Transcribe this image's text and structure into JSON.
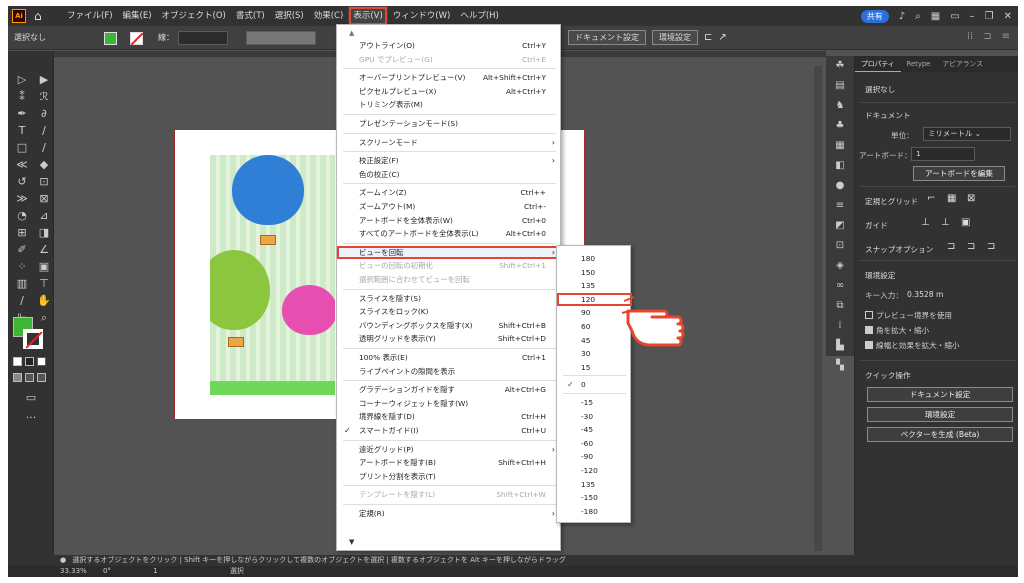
{
  "menubar": {
    "logo": "Ai",
    "items": [
      "ファイル(F)",
      "編集(E)",
      "オブジェクト(O)",
      "書式(T)",
      "選択(S)",
      "効果(C)",
      "表示(V)",
      "ウィンドウ(W)",
      "ヘルプ(H)"
    ],
    "active_index": 6,
    "share_label": "共有"
  },
  "controlbar": {
    "selection_label": "選択なし",
    "stroke_label": "線：",
    "document_setup": "ドキュメント設定",
    "preferences": "環境設定"
  },
  "view_menu": {
    "items": [
      {
        "label": "アウトライン(O)",
        "shortcut": "Ctrl+Y"
      },
      {
        "label": "GPU でプレビュー(G)",
        "shortcut": "Ctrl+E",
        "disabled": true
      },
      {
        "sep": true
      },
      {
        "label": "オーバープリントプレビュー(V)",
        "shortcut": "Alt+Shift+Ctrl+Y"
      },
      {
        "label": "ピクセルプレビュー(X)",
        "shortcut": "Alt+Ctrl+Y"
      },
      {
        "label": "トリミング表示(M)",
        "shortcut": ""
      },
      {
        "sep": true
      },
      {
        "label": "プレゼンテーションモード(S)",
        "shortcut": ""
      },
      {
        "sep": true
      },
      {
        "label": "スクリーンモード",
        "shortcut": "",
        "submenu": true
      },
      {
        "sep": true
      },
      {
        "label": "校正設定(F)",
        "shortcut": "",
        "submenu": true
      },
      {
        "label": "色の校正(C)",
        "shortcut": ""
      },
      {
        "sep": true
      },
      {
        "label": "ズームイン(Z)",
        "shortcut": "Ctrl++"
      },
      {
        "label": "ズームアウト(M)",
        "shortcut": "Ctrl+-"
      },
      {
        "label": "アートボードを全体表示(W)",
        "shortcut": "Ctrl+0"
      },
      {
        "label": "すべてのアートボードを全体表示(L)",
        "shortcut": "Alt+Ctrl+0"
      },
      {
        "sep": true
      },
      {
        "label": "ビューを回転",
        "shortcut": "",
        "submenu": true,
        "highlight": true
      },
      {
        "label": "ビューの回転の初期化",
        "shortcut": "Shift+Ctrl+1",
        "disabled": true
      },
      {
        "label": "選択範囲に合わせてビューを回転",
        "shortcut": "",
        "disabled": true
      },
      {
        "sep": true
      },
      {
        "label": "スライスを隠す(S)",
        "shortcut": ""
      },
      {
        "label": "スライスをロック(K)",
        "shortcut": ""
      },
      {
        "label": "バウンディングボックスを隠す(X)",
        "shortcut": "Shift+Ctrl+B"
      },
      {
        "label": "透明グリッドを表示(Y)",
        "shortcut": "Shift+Ctrl+D"
      },
      {
        "sep": true
      },
      {
        "label": "100% 表示(E)",
        "shortcut": "Ctrl+1"
      },
      {
        "label": "ライブペイントの隙間を表示",
        "shortcut": ""
      },
      {
        "sep": true
      },
      {
        "label": "グラデーションガイドを隠す",
        "shortcut": "Alt+Ctrl+G"
      },
      {
        "label": "コーナーウィジェットを隠す(W)",
        "shortcut": ""
      },
      {
        "label": "境界線を隠す(D)",
        "shortcut": "Ctrl+H"
      },
      {
        "label": "スマートガイド(I)",
        "shortcut": "Ctrl+U",
        "checked": true
      },
      {
        "sep": true
      },
      {
        "label": "遠近グリッド(P)",
        "shortcut": "",
        "submenu": true
      },
      {
        "label": "アートボードを隠す(B)",
        "shortcut": "Shift+Ctrl+H"
      },
      {
        "label": "プリント分割を表示(T)",
        "shortcut": ""
      },
      {
        "sep": true
      },
      {
        "label": "テンプレートを隠す(L)",
        "shortcut": "Shift+Ctrl+W",
        "disabled": true
      },
      {
        "sep": true
      },
      {
        "label": "定規(R)",
        "shortcut": "",
        "submenu": true
      }
    ]
  },
  "rotate_submenu": {
    "items": [
      {
        "label": "180"
      },
      {
        "label": "150"
      },
      {
        "label": "135"
      },
      {
        "label": "120",
        "highlight": true
      },
      {
        "label": "90"
      },
      {
        "label": "60"
      },
      {
        "label": "45"
      },
      {
        "label": "30"
      },
      {
        "label": "15"
      },
      {
        "sep": true
      },
      {
        "label": "0",
        "checked": true
      },
      {
        "sep": true
      },
      {
        "label": "-15"
      },
      {
        "label": "-30"
      },
      {
        "label": "-45"
      },
      {
        "label": "-60"
      },
      {
        "label": "-90"
      },
      {
        "label": "-120"
      },
      {
        "label": "135"
      },
      {
        "label": "-150"
      },
      {
        "label": "-180"
      }
    ]
  },
  "panel": {
    "tabs": [
      "プロパティ",
      "Retype",
      "アピアランス"
    ],
    "no_selection": "選択なし",
    "document": "ドキュメント",
    "units_label": "単位：",
    "units_value": "ミリメートル",
    "artboard_label": "アートボード：",
    "artboard_value": "1",
    "edit_artboard": "アートボードを編集",
    "rulers_grid": "定規とグリッド",
    "guides": "ガイド",
    "snap_options": "スナップオプション",
    "preferences": "環境設定",
    "key_increment_label": "キー入力：",
    "key_increment_value": "0.3528 m",
    "preview_bounds": "プレビュー境界を使用",
    "scale_corners": "角を拡大・縮小",
    "scale_strokes": "線幅と効果を拡大・縮小",
    "quick_actions": "クイック操作",
    "document_setup_btn": "ドキュメント設定",
    "preferences_btn": "環境設定",
    "vectorize_btn": "ベクターを生成 (Beta)"
  },
  "status": {
    "hint": "選択するオブジェクトをクリック | Shift キーを押しながらクリックして複数のオブジェクトを選択 | 複数するオブジェクトを Alt キーを押しながらドラッグ",
    "zoom": "33.33%",
    "rotation": "0°",
    "artboard_num": "1",
    "tool": "選択"
  }
}
